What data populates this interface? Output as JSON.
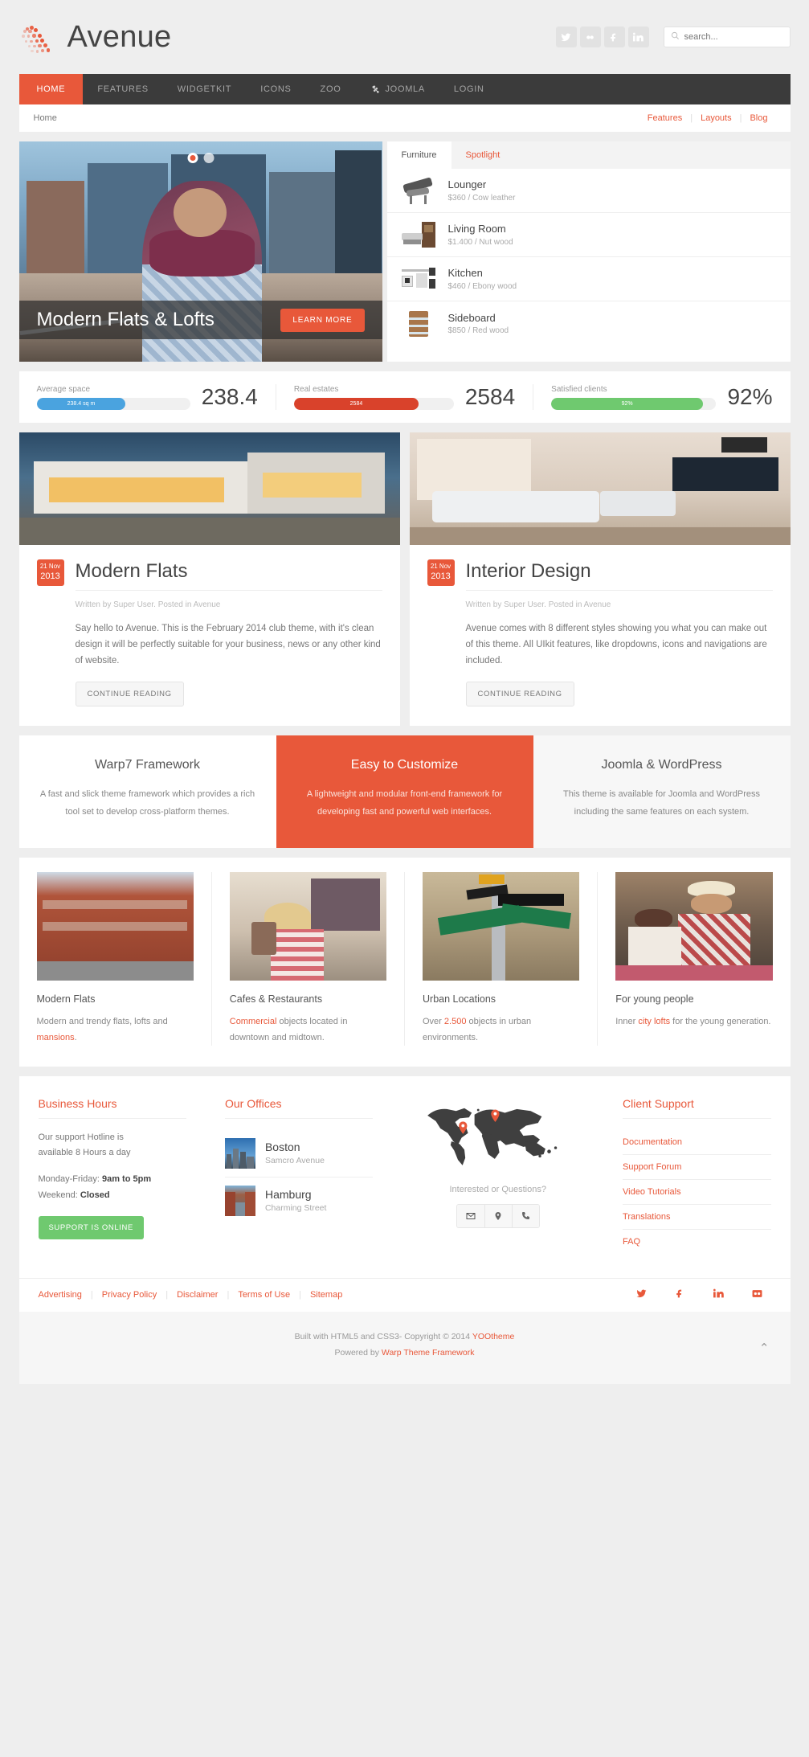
{
  "header": {
    "brand": "Avenue",
    "social": [
      "twitter-icon",
      "flickr-icon",
      "facebook-icon",
      "linkedin-icon"
    ],
    "search_placeholder": "search...",
    "search_value": ""
  },
  "nav": {
    "items": [
      {
        "label": "HOME",
        "active": true
      },
      {
        "label": "FEATURES",
        "active": false
      },
      {
        "label": "WIDGETKIT",
        "active": false
      },
      {
        "label": "ICONS",
        "active": false
      },
      {
        "label": "ZOO",
        "active": false
      },
      {
        "label": "JOOMLA",
        "active": false,
        "icon": "joomla-icon"
      },
      {
        "label": "LOGIN",
        "active": false
      }
    ]
  },
  "breadcrumb": {
    "current": "Home",
    "links": [
      "Features",
      "Layouts",
      "Blog"
    ]
  },
  "hero": {
    "title": "Modern Flats & Lofts",
    "button": "LEARN MORE",
    "slide_count": 2,
    "active_slide": 1
  },
  "products": {
    "tabs": [
      {
        "label": "Furniture",
        "active": true
      },
      {
        "label": "Spotlight",
        "active": false
      }
    ],
    "items": [
      {
        "name": "Lounger",
        "meta": "$360 / Cow leather",
        "icon": "lounger-thumb"
      },
      {
        "name": "Living Room",
        "meta": "$1.400 / Nut wood",
        "icon": "living-room-thumb"
      },
      {
        "name": "Kitchen",
        "meta": "$460 / Ebony wood",
        "icon": "kitchen-thumb"
      },
      {
        "name": "Sideboard",
        "meta": "$850 / Red wood",
        "icon": "sideboard-thumb"
      }
    ]
  },
  "stats": [
    {
      "label": "Average space",
      "bar_text": "238.4 sq m",
      "value": "238.4",
      "percent": 58,
      "color": "#4aa3df"
    },
    {
      "label": "Real estates",
      "bar_text": "2584",
      "value": "2584",
      "percent": 78,
      "color": "#d9422b"
    },
    {
      "label": "Satisfied clients",
      "bar_text": "92%",
      "value": "92%",
      "percent": 92,
      "color": "#6fc96f"
    }
  ],
  "articles": [
    {
      "date_day": "21 Nov",
      "date_year": "2013",
      "title": "Modern Flats",
      "byline": "Written by Super User. Posted in Avenue",
      "text": "Say hello to Avenue. This is the February 2014 club theme, with it's clean design it will be perfectly suitable for your business, news or any other kind of website.",
      "button": "CONTINUE READING"
    },
    {
      "date_day": "21 Nov",
      "date_year": "2013",
      "title": "Interior Design",
      "byline": "Written by Super User. Posted in Avenue",
      "text": "Avenue comes with 8 different styles showing you what you can make out of this theme. All UIkit features, like dropdowns, icons and navigations are included.",
      "button": "CONTINUE READING"
    }
  ],
  "panels": [
    {
      "title": "Warp7 Framework",
      "text": "A fast and slick theme framework which provides a rich tool set to develop cross-platform themes.",
      "highlight": false
    },
    {
      "title": "Easy to Customize",
      "text": "A lightweight and modular front-end framework for developing fast and powerful web interfaces.",
      "highlight": true
    },
    {
      "title": "Joomla & WordPress",
      "text": "This theme is available for Joomla and WordPress including the same features on each system.",
      "highlight": false
    }
  ],
  "gallery": [
    {
      "title": "Modern Flats",
      "pre": "Modern and trendy flats, lofts and ",
      "link": "mansions",
      "post": "."
    },
    {
      "title": "Cafes & Restaurants",
      "pre": "",
      "link": "Commercial",
      "post": " objects located in downtown and midtown."
    },
    {
      "title": "Urban Locations",
      "pre": "Over ",
      "link": "2.500",
      "post": " objects in urban environments."
    },
    {
      "title": "For young people",
      "pre": "Inner ",
      "link": "city lofts",
      "post": " for the young generation."
    }
  ],
  "footer": {
    "business": {
      "heading": "Business Hours",
      "line1": "Our support Hotline is",
      "line2": "available 8 Hours a day",
      "weekday_label": "Monday-Friday: ",
      "weekday_value": "9am to 5pm",
      "weekend_label": "Weekend: ",
      "weekend_value": "Closed",
      "button": "SUPPORT IS ONLINE"
    },
    "offices": {
      "heading": "Our Offices",
      "items": [
        {
          "name": "Boston",
          "street": "Samcro Avenue"
        },
        {
          "name": "Hamburg",
          "street": "Charming Street"
        }
      ]
    },
    "map": {
      "question": "Interested or Questions?",
      "icons": [
        "mail-icon",
        "location-pin-icon",
        "phone-icon"
      ]
    },
    "support": {
      "heading": "Client Support",
      "links": [
        "Documentation",
        "Support Forum",
        "Video Tutorials",
        "Translations",
        "FAQ"
      ]
    },
    "links": [
      "Advertising",
      "Privacy Policy",
      "Disclaimer",
      "Terms of Use",
      "Sitemap"
    ],
    "social": [
      "twitter-icon",
      "facebook-icon",
      "linkedin-icon",
      "flickr-icon"
    ],
    "copyright_pre": "Built with HTML5 and CSS3- Copyright © 2014 ",
    "copyright_link": "YOOtheme",
    "powered_pre": "Powered by ",
    "powered_link": "Warp Theme Framework",
    "to_top": "⌃"
  }
}
